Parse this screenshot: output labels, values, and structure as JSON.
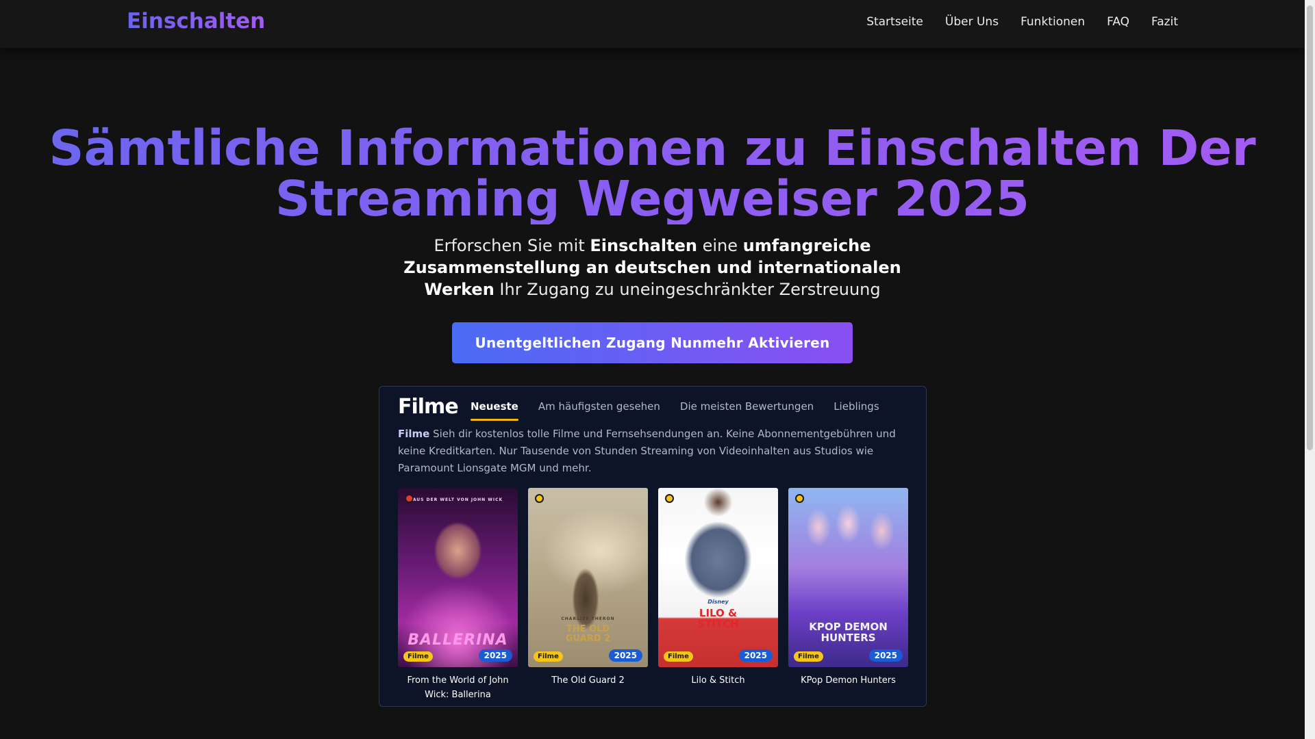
{
  "header": {
    "logo": "Einschalten",
    "nav": [
      "Startseite",
      "Über Uns",
      "Funktionen",
      "FAQ",
      "Fazit"
    ]
  },
  "hero": {
    "title_line1": "Sämtliche Informationen zu Einschalten Der",
    "title_line2": "Streaming Wegweiser 2025",
    "subtitle": {
      "p1": "Erforschen Sie mit ",
      "b1": "Einschalten",
      "p2": " eine ",
      "b2": "umfangreiche Zusammenstellung an deutschen und internationalen Werken",
      "p3": " Ihr Zugang zu uneingeschränkter Zerstreuung"
    },
    "cta_label": "Unentgeltlichen Zugang Nunmehr Aktivieren"
  },
  "preview": {
    "title": "Filme",
    "tabs": [
      "Neueste",
      "Am häufigsten gesehen",
      "Die meisten Bewertungen",
      "Lieblings"
    ],
    "active_tab": 0,
    "desc_bold": "Filme",
    "desc_text": " Sieh dir kostenlos tolle Filme und Fernsehsendungen an. Keine Abonnementgebühren und keine Kreditkarten. Nur Tausende von Stunden Streaming von Videoinhalten aus Studios wie Paramount Lionsgate MGM und mehr.",
    "cards": [
      {
        "title": "From the World of John Wick: Ballerina",
        "genre": "Filme",
        "year": "2025",
        "poster_top": "AUS DER WELT VON JOHN WICK",
        "poster_main": "BALLERINA",
        "dot_color": "#e53935"
      },
      {
        "title": "The Old Guard 2",
        "genre": "Filme",
        "year": "2025",
        "poster_top": "CHARLIZE THERON",
        "poster_main": "THE OLD GUARD 2",
        "dot_color": "#f5c518"
      },
      {
        "title": "Lilo & Stitch",
        "genre": "Filme",
        "year": "2025",
        "poster_top": "Disney",
        "poster_main": "LILO & STITCH",
        "dot_color": "#f5c518"
      },
      {
        "title": "KPop Demon Hunters",
        "genre": "Filme",
        "year": "2025",
        "poster_top": "",
        "poster_main": "KPOP DEMON HUNTERS",
        "dot_color": "#f5c518"
      }
    ]
  },
  "colors": {
    "background": "#121212",
    "accent_start": "#6b63f0",
    "accent_end": "#a35cf2",
    "panel_bg": "#0e1427",
    "tab_underline": "#f0b90b",
    "genre_badge": "#f5c518",
    "year_badge": "#1a5bd6"
  }
}
